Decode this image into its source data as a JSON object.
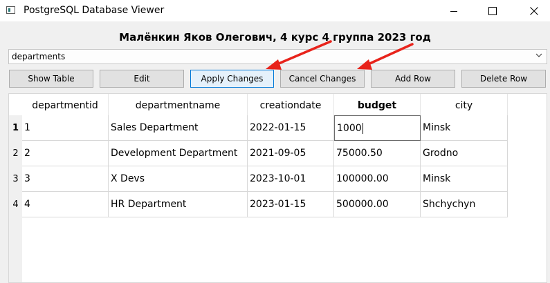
{
  "window": {
    "title": "PostgreSQL Database Viewer",
    "icons": [
      "app-icon",
      "minimize-icon",
      "maximize-icon",
      "close-icon"
    ]
  },
  "heading": "Малёнкин Яков Олегович, 4 курс 4 группа 2023 год",
  "table_select": {
    "value": "departments",
    "icon": "chevron-down-icon"
  },
  "toolbar": {
    "show_table": "Show Table",
    "edit": "Edit",
    "apply_changes": "Apply Changes",
    "cancel_changes": "Cancel Changes",
    "add_row": "Add Row",
    "delete_row": "Delete Row"
  },
  "grid": {
    "columns": [
      "departmentid",
      "departmentname",
      "creationdate",
      "budget",
      "city"
    ],
    "row_numbers": [
      "1",
      "2",
      "3",
      "4"
    ],
    "rows": [
      [
        "1",
        "Sales Department",
        "2022-01-15",
        "1000",
        "Minsk"
      ],
      [
        "2",
        "Development Department",
        "2021-09-05",
        "75000.50",
        "Grodno"
      ],
      [
        "3",
        "X Devs",
        "2023-10-01",
        "100000.00",
        "Minsk"
      ],
      [
        "4",
        "HR Department",
        "2023-01-15",
        "500000.00",
        "Shchychyn"
      ]
    ],
    "current_row": 1,
    "current_column": "budget"
  },
  "annotation": {
    "arrow_color": "#e8231b",
    "targets": [
      "Apply Changes",
      "Cancel Changes"
    ]
  }
}
